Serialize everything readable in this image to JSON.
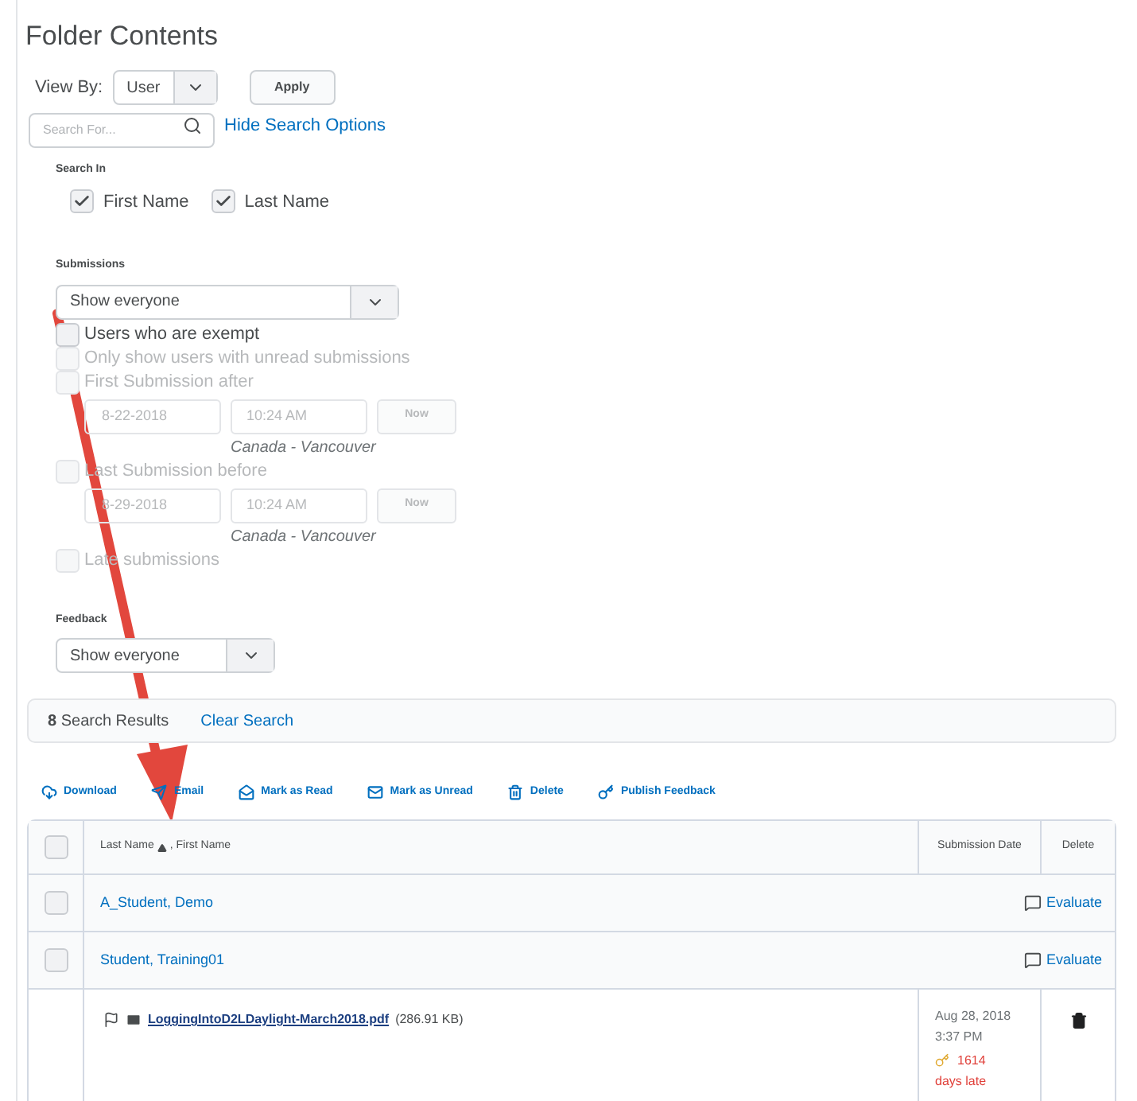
{
  "title": "Folder Contents",
  "view_by": {
    "label": "View By:",
    "value": "User",
    "apply": "Apply"
  },
  "search": {
    "placeholder": "Search For...",
    "toggle": "Hide Search Options"
  },
  "search_in": {
    "label": "Search In",
    "options": [
      {
        "label": "First Name",
        "checked": true
      },
      {
        "label": "Last Name",
        "checked": true
      }
    ]
  },
  "submissions": {
    "label": "Submissions",
    "value": "Show everyone",
    "filters": [
      {
        "kind": "check",
        "label": "Users who are exempt",
        "checked": false,
        "disabled": false
      },
      {
        "kind": "check",
        "label": "Only show users with unread submissions",
        "checked": false,
        "disabled": true
      },
      {
        "kind": "check",
        "label": "First Submission after",
        "checked": false,
        "disabled": true
      },
      {
        "kind": "datetime",
        "date": "8-22-2018",
        "time": "10:24 AM",
        "now": "Now",
        "zone": "Canada - Vancouver"
      },
      {
        "kind": "check",
        "label": "Last Submission before",
        "checked": false,
        "disabled": true
      },
      {
        "kind": "datetime",
        "date": "8-29-2018",
        "time": "10:24 AM",
        "now": "Now",
        "zone": "Canada - Vancouver"
      },
      {
        "kind": "check",
        "label": "Late submissions",
        "checked": false,
        "disabled": true
      }
    ]
  },
  "feedback": {
    "label": "Feedback",
    "value": "Show everyone"
  },
  "results": {
    "count": "8",
    "text": "Search Results",
    "clear": "Clear Search"
  },
  "toolbar": [
    {
      "kind": "download",
      "label": "Download"
    },
    {
      "kind": "email",
      "label": "Email"
    },
    {
      "kind": "read",
      "label": "Mark as Read"
    },
    {
      "kind": "unread",
      "label": "Mark as Unread"
    },
    {
      "kind": "delete",
      "label": "Delete"
    },
    {
      "kind": "publish",
      "label": "Publish Feedback"
    }
  ],
  "table": {
    "header_checked": false,
    "columns": [
      "Last Name",
      ", First Name",
      "Submission Date",
      "Delete"
    ],
    "rows": [
      {
        "kind": "user",
        "name": "A_Student, Demo",
        "checked": false,
        "action": "Evaluate"
      },
      {
        "kind": "user",
        "name": "Student, Training01",
        "checked": false,
        "action": "Evaluate"
      },
      {
        "kind": "file",
        "file": "LoggingIntoD2LDaylight-March2018.pdf",
        "size": "(286.91 KB)",
        "date": "Aug 28, 2018",
        "time": "3:37 PM",
        "late": "1614",
        "late_text": "days late"
      }
    ]
  }
}
